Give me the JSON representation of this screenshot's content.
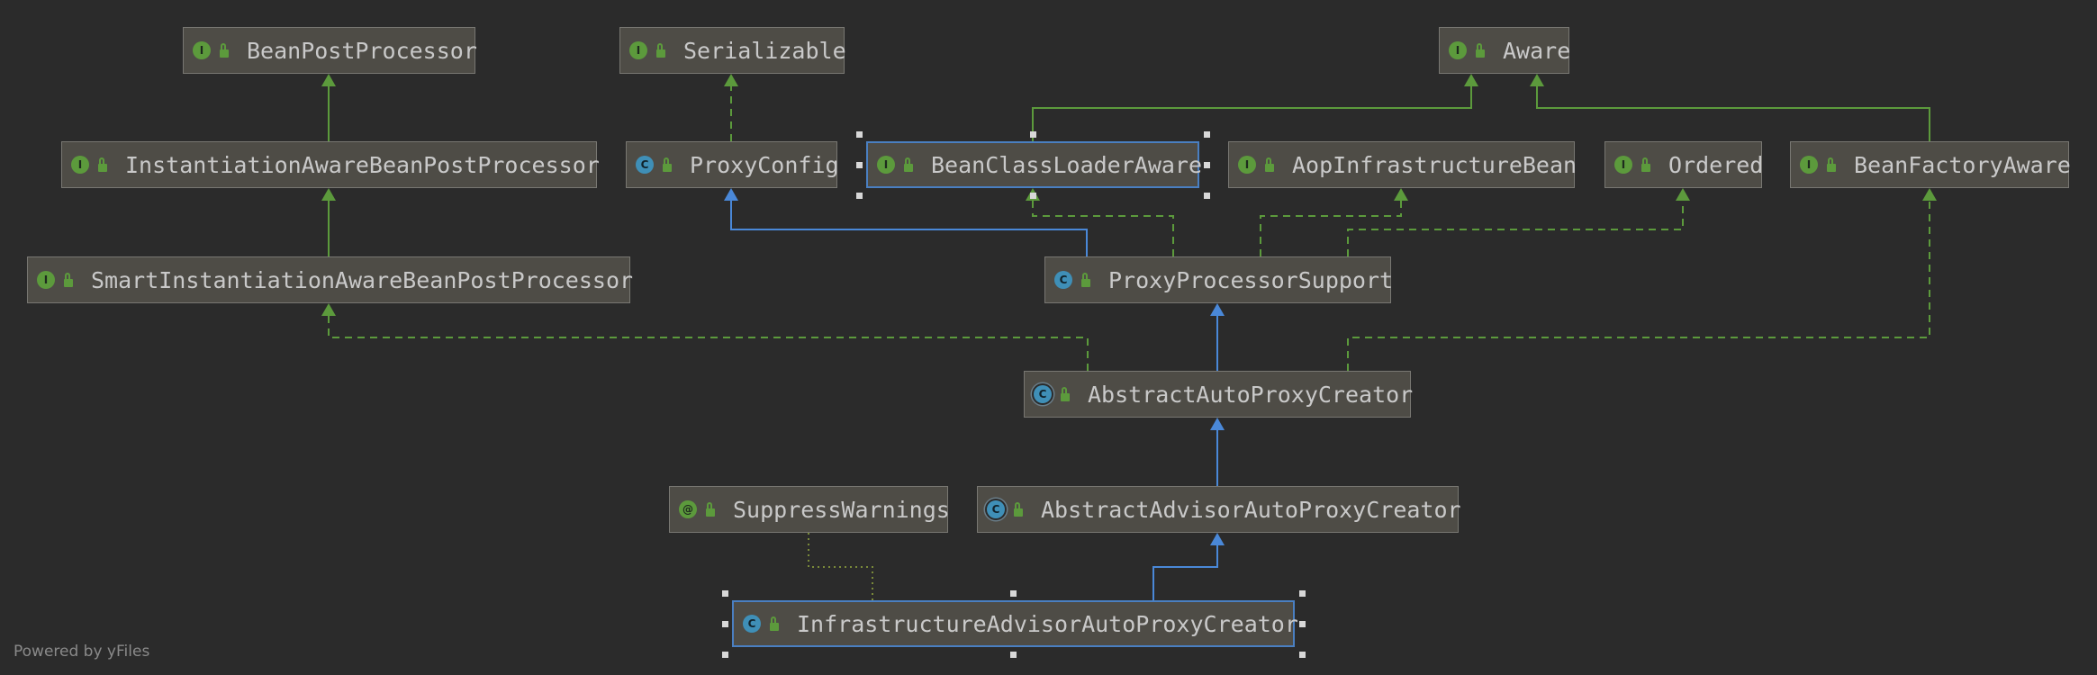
{
  "diagram": {
    "nodes": [
      {
        "id": "bean-post-processor",
        "name": "BeanPostProcessor",
        "kind": "interface",
        "kind_glyph": "I"
      },
      {
        "id": "serializable",
        "name": "Serializable",
        "kind": "interface",
        "kind_glyph": "I"
      },
      {
        "id": "aware",
        "name": "Aware",
        "kind": "interface",
        "kind_glyph": "I"
      },
      {
        "id": "instantiation-aware-bean-post-processor",
        "name": "InstantiationAwareBeanPostProcessor",
        "kind": "interface",
        "kind_glyph": "I"
      },
      {
        "id": "proxy-config",
        "name": "ProxyConfig",
        "kind": "class",
        "kind_glyph": "C"
      },
      {
        "id": "bean-class-loader-aware",
        "name": "BeanClassLoaderAware",
        "kind": "interface",
        "kind_glyph": "I",
        "selected": true
      },
      {
        "id": "aop-infrastructure-bean",
        "name": "AopInfrastructureBean",
        "kind": "interface",
        "kind_glyph": "I"
      },
      {
        "id": "ordered",
        "name": "Ordered",
        "kind": "interface",
        "kind_glyph": "I"
      },
      {
        "id": "bean-factory-aware",
        "name": "BeanFactoryAware",
        "kind": "interface",
        "kind_glyph": "I"
      },
      {
        "id": "smart-instantiation-aware-bean-post-processor",
        "name": "SmartInstantiationAwareBeanPostProcessor",
        "kind": "interface",
        "kind_glyph": "I"
      },
      {
        "id": "proxy-processor-support",
        "name": "ProxyProcessorSupport",
        "kind": "class",
        "kind_glyph": "C"
      },
      {
        "id": "abstract-auto-proxy-creator",
        "name": "AbstractAutoProxyCreator",
        "kind": "abstract",
        "kind_glyph": "C"
      },
      {
        "id": "suppress-warnings",
        "name": "SuppressWarnings",
        "kind": "annotation",
        "kind_glyph": "@"
      },
      {
        "id": "abstract-advisor-auto-proxy-creator",
        "name": "AbstractAdvisorAutoProxyCreator",
        "kind": "abstract",
        "kind_glyph": "C"
      },
      {
        "id": "infrastructure-advisor-auto-proxy-creator",
        "name": "InfrastructureAdvisorAutoProxyCreator",
        "kind": "class",
        "kind_glyph": "C",
        "selected": true
      }
    ],
    "edges": [
      {
        "from": "instantiation-aware-bean-post-processor",
        "to": "bean-post-processor",
        "type": "extends-interface"
      },
      {
        "from": "smart-instantiation-aware-bean-post-processor",
        "to": "instantiation-aware-bean-post-processor",
        "type": "extends-interface"
      },
      {
        "from": "proxy-config",
        "to": "serializable",
        "type": "implements"
      },
      {
        "from": "bean-class-loader-aware",
        "to": "aware",
        "type": "extends-interface"
      },
      {
        "from": "bean-factory-aware",
        "to": "aware",
        "type": "extends-interface"
      },
      {
        "from": "proxy-processor-support",
        "to": "proxy-config",
        "type": "extends-class"
      },
      {
        "from": "proxy-processor-support",
        "to": "bean-class-loader-aware",
        "type": "implements"
      },
      {
        "from": "proxy-processor-support",
        "to": "aop-infrastructure-bean",
        "type": "implements"
      },
      {
        "from": "proxy-processor-support",
        "to": "ordered",
        "type": "implements"
      },
      {
        "from": "abstract-auto-proxy-creator",
        "to": "proxy-processor-support",
        "type": "extends-class"
      },
      {
        "from": "abstract-auto-proxy-creator",
        "to": "smart-instantiation-aware-bean-post-processor",
        "type": "implements"
      },
      {
        "from": "abstract-auto-proxy-creator",
        "to": "bean-factory-aware",
        "type": "implements"
      },
      {
        "from": "abstract-advisor-auto-proxy-creator",
        "to": "abstract-auto-proxy-creator",
        "type": "extends-class"
      },
      {
        "from": "infrastructure-advisor-auto-proxy-creator",
        "to": "abstract-advisor-auto-proxy-creator",
        "type": "extends-class"
      },
      {
        "from": "infrastructure-advisor-auto-proxy-creator",
        "to": "suppress-warnings",
        "type": "annotated-with"
      }
    ],
    "colors": {
      "background": "#2b2b2b",
      "node_fill": "#4e4c46",
      "node_border": "#787772",
      "selected_border": "#4a7fc1",
      "interface_edge": "#5c9a3c",
      "class_edge": "#4a88d8",
      "annotation_edge": "#7a8a3a",
      "text": "#c9c9c9"
    }
  },
  "footer": {
    "watermark": "Powered by yFiles"
  }
}
